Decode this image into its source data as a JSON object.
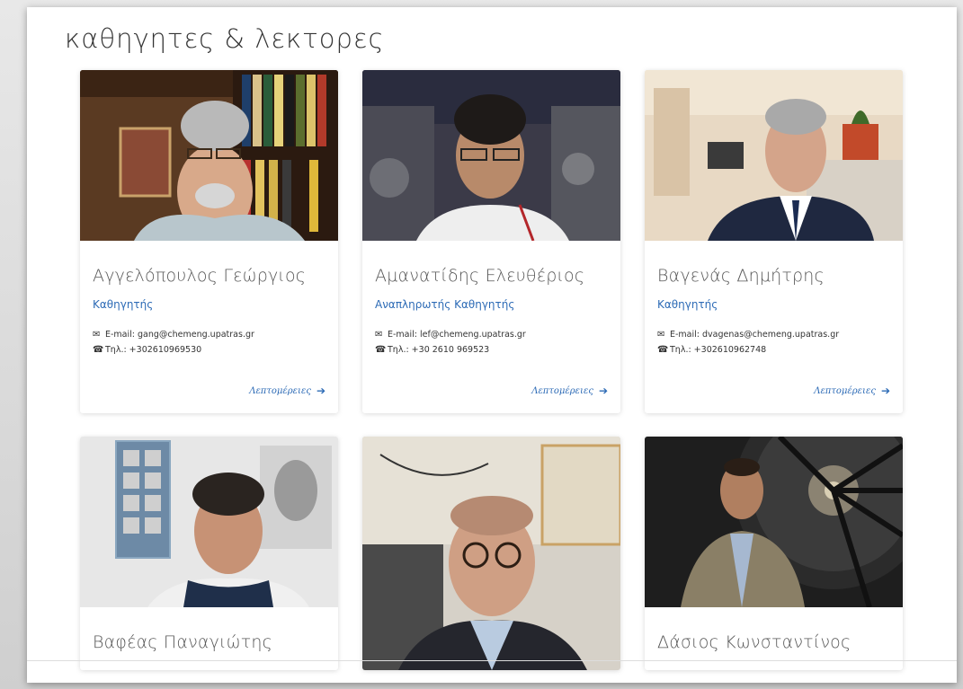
{
  "page": {
    "title": "καθηγητες & λεκτορες"
  },
  "labels": {
    "email_prefix": "E-mail: ",
    "phone_prefix": "Τηλ.: ",
    "details_link": "Λεπτομέρειες"
  },
  "faculty": [
    {
      "name": "Αγγελόπουλος Γεώργιος",
      "role": "Καθηγητής",
      "email": "E-mail: gang@chemeng.upatras.gr",
      "phone": "Τηλ.: +302610969530",
      "details": "Λεπτομέρειες"
    },
    {
      "name": "Αμανατίδης Ελευθέριος",
      "role": "Αναπληρωτής Καθηγητής",
      "email": "E-mail: lef@chemeng.upatras.gr",
      "phone": "Τηλ.: +30 2610 969523",
      "details": "Λεπτομέρειες"
    },
    {
      "name": "Βαγενάς Δημήτρης",
      "role": "Καθηγητής",
      "email": "E-mail: dvagenas@chemeng.upatras.gr",
      "phone": "Τηλ.: +302610962748",
      "details": "Λεπτομέρειες"
    },
    {
      "name": "Βαφέας Παναγιώτης"
    },
    {
      "name": ""
    },
    {
      "name": "Δάσιος Κωνσταντίνος"
    }
  ],
  "icons": {
    "email": "envelope-icon",
    "phone": "phone-icon",
    "arrow": "arrow-right-icon"
  },
  "colors": {
    "accent": "#2d6bb6",
    "text": "#555555"
  }
}
